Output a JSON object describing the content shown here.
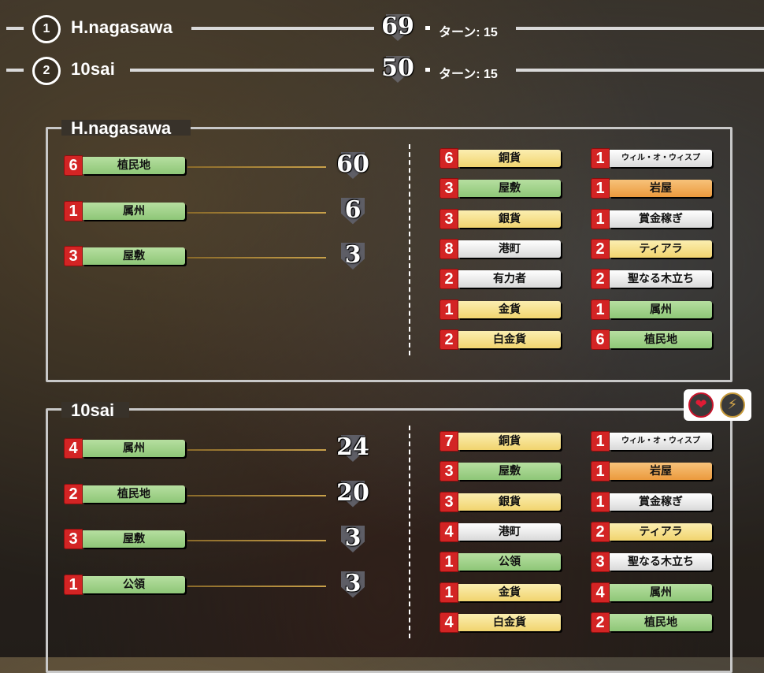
{
  "ranking": [
    {
      "rank": "1",
      "name": "H.nagasawa",
      "score": "69",
      "turn": "ターン: 15"
    },
    {
      "rank": "2",
      "name": "10sai",
      "score": "50",
      "turn": "ターン: 15"
    }
  ],
  "players": [
    {
      "name": "H.nagasawa",
      "scoring": [
        {
          "count": "6",
          "label": "植民地",
          "points": "60"
        },
        {
          "count": "1",
          "label": "属州",
          "points": "6"
        },
        {
          "count": "3",
          "label": "屋敷",
          "points": "3"
        }
      ],
      "cards_left": [
        {
          "count": "6",
          "label": "銅貨",
          "color": "yellow"
        },
        {
          "count": "3",
          "label": "屋敷",
          "color": "green"
        },
        {
          "count": "3",
          "label": "銀貨",
          "color": "yellow"
        },
        {
          "count": "8",
          "label": "港町",
          "color": "white"
        },
        {
          "count": "2",
          "label": "有力者",
          "color": "white"
        },
        {
          "count": "1",
          "label": "金貨",
          "color": "yellow"
        },
        {
          "count": "2",
          "label": "白金貨",
          "color": "yellow"
        }
      ],
      "cards_right": [
        {
          "count": "1",
          "label": "ウィル・オ・ウィスプ",
          "color": "white"
        },
        {
          "count": "1",
          "label": "岩屋",
          "color": "orange"
        },
        {
          "count": "1",
          "label": "賞金稼ぎ",
          "color": "white"
        },
        {
          "count": "2",
          "label": "ティアラ",
          "color": "yellow"
        },
        {
          "count": "2",
          "label": "聖なる木立ち",
          "color": "white"
        },
        {
          "count": "1",
          "label": "属州",
          "color": "green"
        },
        {
          "count": "6",
          "label": "植民地",
          "color": "green"
        }
      ]
    },
    {
      "name": "10sai",
      "scoring": [
        {
          "count": "4",
          "label": "属州",
          "points": "24"
        },
        {
          "count": "2",
          "label": "植民地",
          "points": "20"
        },
        {
          "count": "3",
          "label": "屋敷",
          "points": "3"
        },
        {
          "count": "1",
          "label": "公領",
          "points": "3"
        }
      ],
      "cards_left": [
        {
          "count": "7",
          "label": "銅貨",
          "color": "yellow"
        },
        {
          "count": "3",
          "label": "屋敷",
          "color": "green"
        },
        {
          "count": "3",
          "label": "銀貨",
          "color": "yellow"
        },
        {
          "count": "4",
          "label": "港町",
          "color": "white"
        },
        {
          "count": "1",
          "label": "公領",
          "color": "green"
        },
        {
          "count": "1",
          "label": "金貨",
          "color": "yellow"
        },
        {
          "count": "4",
          "label": "白金貨",
          "color": "yellow"
        }
      ],
      "cards_right": [
        {
          "count": "1",
          "label": "ウィル・オ・ウィスプ",
          "color": "white"
        },
        {
          "count": "1",
          "label": "岩屋",
          "color": "orange"
        },
        {
          "count": "1",
          "label": "賞金稼ぎ",
          "color": "white"
        },
        {
          "count": "2",
          "label": "ティアラ",
          "color": "yellow"
        },
        {
          "count": "3",
          "label": "聖なる木立ち",
          "color": "white"
        },
        {
          "count": "4",
          "label": "属州",
          "color": "green"
        },
        {
          "count": "2",
          "label": "植民地",
          "color": "green"
        }
      ]
    }
  ],
  "badges": {
    "heart_icon": "heart-icon",
    "bolt_icon": "bolt-icon"
  }
}
